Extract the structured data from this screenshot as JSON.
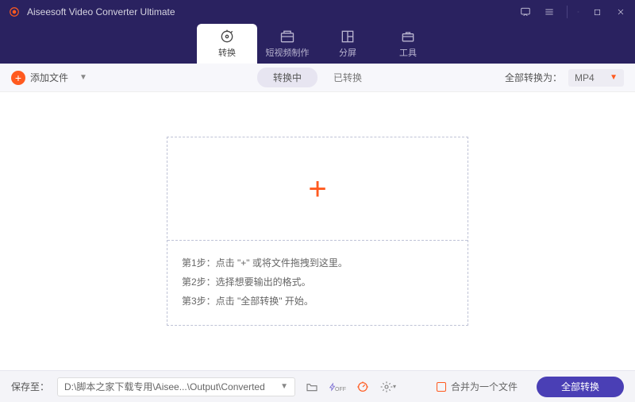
{
  "app": {
    "title": "Aiseesoft Video Converter Ultimate"
  },
  "tabs": {
    "convert": "转换",
    "mv": "短视频制作",
    "collage": "分屏",
    "toolbox": "工具"
  },
  "toolbar": {
    "add_file": "添加文件",
    "subtab_converting": "转换中",
    "subtab_converted": "已转换",
    "convert_all_label": "全部转换为：",
    "format": "MP4"
  },
  "dropzone": {
    "step1": "第1步：点击 \"+\" 或将文件拖拽到这里。",
    "step2": "第2步：选择想要输出的格式。",
    "step3": "第3步：点击 \"全部转换\" 开始。"
  },
  "bottom": {
    "save_to": "保存至：",
    "path": "D:\\脚本之家下载专用\\Aisee...\\Output\\Converted",
    "merge": "合并为一个文件",
    "convert_all": "全部转换"
  }
}
